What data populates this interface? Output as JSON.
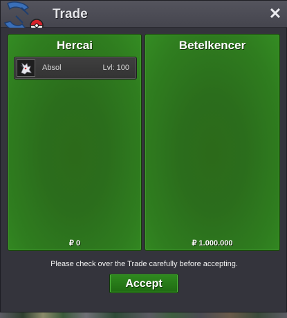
{
  "window": {
    "title": "Trade",
    "close_symbol": "✕"
  },
  "left_panel": {
    "player_name": "Hercai",
    "pokemon": [
      {
        "name": "Absol",
        "level_label": "Lvl: 100",
        "icon": "absol-sprite-icon"
      }
    ],
    "money": "₽ 0"
  },
  "right_panel": {
    "player_name": "Betelkencer",
    "pokemon": [],
    "money": "₽ 1.000.000"
  },
  "notice": "Please check over the Trade carefully before accepting.",
  "accept_label": "Accept",
  "colors": {
    "panel_green": "#2f7d1f",
    "button_green": "#2f8a1f",
    "titlebar": "#4d4d56",
    "window_bg": "#33333b"
  }
}
